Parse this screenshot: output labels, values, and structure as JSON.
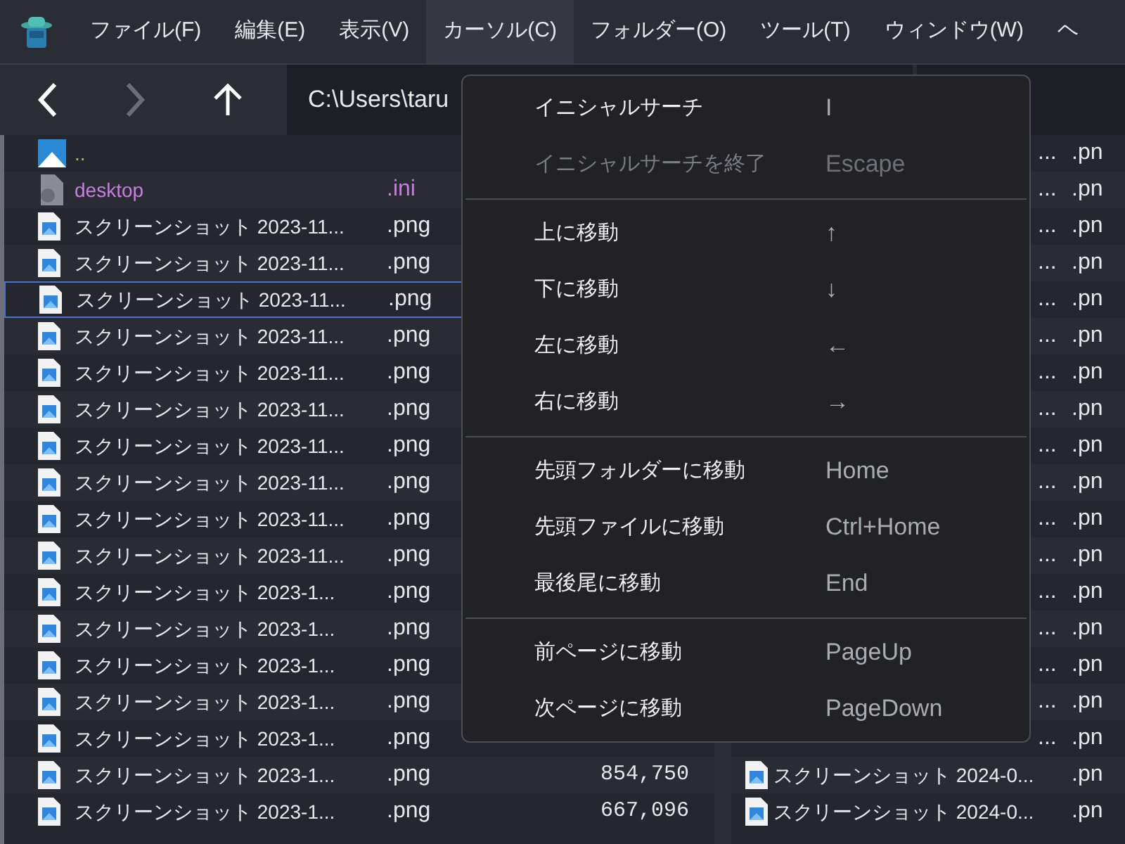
{
  "menu_bar": [
    {
      "label": "ファイル(F)",
      "selected": false
    },
    {
      "label": "編集(E)",
      "selected": false
    },
    {
      "label": "表示(V)",
      "selected": false
    },
    {
      "label": "カーソル(C)",
      "selected": true
    },
    {
      "label": "フォルダー(O)",
      "selected": false
    },
    {
      "label": "ツール(T)",
      "selected": false
    },
    {
      "label": "ウィンドウ(W)",
      "selected": false
    },
    {
      "label": "ヘ",
      "selected": false
    }
  ],
  "toolbar": {
    "back_disabled": false,
    "forward_disabled": true,
    "path": "C:\\Users\\taru"
  },
  "left_pane": {
    "rows": [
      {
        "kind": "parent",
        "name": "..",
        "selected": false
      },
      {
        "kind": "settings",
        "name": "desktop",
        "ext": ".ini",
        "selected": false
      },
      {
        "kind": "image",
        "name": "スクリーンショット 2023-11...",
        "ext": ".png",
        "selected": false
      },
      {
        "kind": "image",
        "name": "スクリーンショット 2023-11...",
        "ext": ".png",
        "selected": false
      },
      {
        "kind": "image",
        "name": "スクリーンショット 2023-11...",
        "ext": ".png",
        "selected": true
      },
      {
        "kind": "image",
        "name": "スクリーンショット 2023-11...",
        "ext": ".png",
        "selected": false
      },
      {
        "kind": "image",
        "name": "スクリーンショット 2023-11...",
        "ext": ".png",
        "selected": false
      },
      {
        "kind": "image",
        "name": "スクリーンショット 2023-11...",
        "ext": ".png",
        "selected": false
      },
      {
        "kind": "image",
        "name": "スクリーンショット 2023-11...",
        "ext": ".png",
        "selected": false
      },
      {
        "kind": "image",
        "name": "スクリーンショット 2023-11...",
        "ext": ".png",
        "selected": false
      },
      {
        "kind": "image",
        "name": "スクリーンショット 2023-11...",
        "ext": ".png",
        "selected": false
      },
      {
        "kind": "image",
        "name": "スクリーンショット 2023-11...",
        "ext": ".png",
        "selected": false
      },
      {
        "kind": "image",
        "name": "スクリーンショット 2023-1...",
        "ext": ".png",
        "selected": false
      },
      {
        "kind": "image",
        "name": "スクリーンショット 2023-1...",
        "ext": ".png",
        "selected": false
      },
      {
        "kind": "image",
        "name": "スクリーンショット 2023-1...",
        "ext": ".png",
        "selected": false
      },
      {
        "kind": "image",
        "name": "スクリーンショット 2023-1...",
        "ext": ".png",
        "selected": false
      },
      {
        "kind": "image",
        "name": "スクリーンショット 2023-1...",
        "ext": ".png",
        "selected": false
      },
      {
        "kind": "image",
        "name": "スクリーンショット 2023-1...",
        "ext": ".png",
        "size": "854,750",
        "selected": false
      },
      {
        "kind": "image",
        "name": "スクリーンショット 2023-1...",
        "ext": ".png",
        "size": "667,096",
        "selected": false
      }
    ]
  },
  "right_pane": {
    "rows": [
      {
        "kind": "partial",
        "name": "...",
        "ext": ".pn"
      },
      {
        "kind": "partial",
        "name": "...",
        "ext": ".pn"
      },
      {
        "kind": "partial",
        "name": "...",
        "ext": ".pn"
      },
      {
        "kind": "partial",
        "name": "...",
        "ext": ".pn"
      },
      {
        "kind": "partial",
        "name": "...",
        "ext": ".pn"
      },
      {
        "kind": "partial",
        "name": "...",
        "ext": ".pn"
      },
      {
        "kind": "partial",
        "name": "...",
        "ext": ".pn"
      },
      {
        "kind": "partial",
        "name": "...",
        "ext": ".pn"
      },
      {
        "kind": "partial",
        "name": "...",
        "ext": ".pn"
      },
      {
        "kind": "partial",
        "name": "...",
        "ext": ".pn"
      },
      {
        "kind": "partial",
        "name": "...",
        "ext": ".pn"
      },
      {
        "kind": "partial",
        "name": "...",
        "ext": ".pn"
      },
      {
        "kind": "partial",
        "name": "...",
        "ext": ".pn"
      },
      {
        "kind": "partial",
        "name": "...",
        "ext": ".pn"
      },
      {
        "kind": "partial",
        "name": "...",
        "ext": ".pn"
      },
      {
        "kind": "partial",
        "name": "...",
        "ext": ".pn"
      },
      {
        "kind": "partial",
        "name": "...",
        "ext": ".pn"
      },
      {
        "kind": "image",
        "name": "スクリーンショット 2024-0...",
        "ext": ".pn"
      },
      {
        "kind": "image",
        "name": "スクリーンショット 2024-0...",
        "ext": ".pn"
      }
    ]
  },
  "cursor_menu": {
    "items": [
      {
        "kind": "item",
        "label": "イニシャルサーチ",
        "shortcut": "I",
        "disabled": false
      },
      {
        "kind": "item",
        "label": "イニシャルサーチを終了",
        "shortcut": "Escape",
        "disabled": true
      },
      {
        "kind": "separator"
      },
      {
        "kind": "item",
        "label": "上に移動",
        "shortcut": "↑",
        "disabled": false
      },
      {
        "kind": "item",
        "label": "下に移動",
        "shortcut": "↓",
        "disabled": false
      },
      {
        "kind": "item",
        "label": "左に移動",
        "shortcut": "←",
        "disabled": false
      },
      {
        "kind": "item",
        "label": "右に移動",
        "shortcut": "→",
        "disabled": false
      },
      {
        "kind": "separator"
      },
      {
        "kind": "item",
        "label": "先頭フォルダーに移動",
        "shortcut": "Home",
        "disabled": false
      },
      {
        "kind": "item",
        "label": "先頭ファイルに移動",
        "shortcut": "Ctrl+Home",
        "disabled": false
      },
      {
        "kind": "item",
        "label": "最後尾に移動",
        "shortcut": "End",
        "disabled": false
      },
      {
        "kind": "separator"
      },
      {
        "kind": "item",
        "label": "前ページに移動",
        "shortcut": "PageUp",
        "disabled": false
      },
      {
        "kind": "item",
        "label": "次ページに移動",
        "shortcut": "PageDown",
        "disabled": false
      }
    ]
  }
}
